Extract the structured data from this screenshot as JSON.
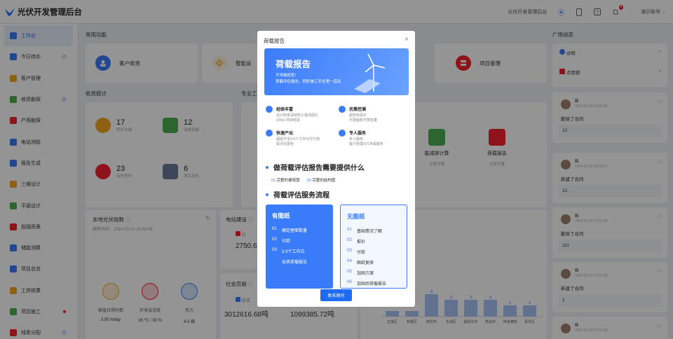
{
  "app": {
    "title": "光伏开发管理后台"
  },
  "topbar": {
    "platform_label": "光伏开发管理后台",
    "notif_count": "3",
    "account_label": "演示账号"
  },
  "sidebar": {
    "items": [
      {
        "label": "工作台",
        "active": true,
        "color": "#3a7bfa"
      },
      {
        "label": "今日待办",
        "badge": "2",
        "badge_type": "green",
        "color": "#3a7bfa"
      },
      {
        "label": "客户管理",
        "color": "#f5a623"
      },
      {
        "label": "收资勘探",
        "badge": "1",
        "badge_type": "blue",
        "color": "#4caf50"
      },
      {
        "label": "产用勘探",
        "color": "#f5222d"
      },
      {
        "label": "电站测绘",
        "color": "#3a7bfa"
      },
      {
        "label": "报告生成",
        "color": "#3a7bfa"
      },
      {
        "label": "三维设计",
        "color": "#f5a623"
      },
      {
        "label": "平面设计",
        "color": "#4caf50"
      },
      {
        "label": "投融资表",
        "color": "#f5222d"
      },
      {
        "label": "储能测算",
        "color": "#3a7bfa"
      },
      {
        "label": "项目总览",
        "color": "#3a7bfa"
      },
      {
        "label": "工资核算",
        "color": "#f5a623"
      },
      {
        "label": "项目施工",
        "dot": true,
        "color": "#4caf50"
      },
      {
        "label": "线索分配",
        "badge": "1",
        "badge_type": "blue",
        "color": "#f5222d"
      }
    ]
  },
  "main": {
    "common_title": "常用功能",
    "quick": [
      {
        "label": "客户收资",
        "color": "#3a7bfa"
      },
      {
        "label": "智能设",
        "color": "#f5a623"
      },
      {
        "label": "项目管理",
        "color": "#f5222d"
      }
    ],
    "stats_title": "收资统计",
    "stats": [
      {
        "num": "17",
        "label": "初步沟通",
        "color": "#f5a623"
      },
      {
        "num": "12",
        "label": "深度挖掘",
        "color": "#4caf50"
      },
      {
        "num": "23",
        "label": "合作签约",
        "color": "#f5222d"
      },
      {
        "num": "6",
        "label": "项目流失",
        "color": "#6b7a99"
      }
    ],
    "pro_title": "专业工",
    "tools": [
      {
        "label": "能减排计算",
        "sub": "立即计算",
        "color": "#4caf50"
      },
      {
        "label": "荷载报告",
        "sub": "立即计算",
        "color": "#f5222d"
      }
    ],
    "pv": {
      "title": "本地光伏指数",
      "update": "更新时间：2024-03-21 10:42:45",
      "items": [
        {
          "label": "峰值日照时数",
          "value": "3.95 h/day",
          "color": "#f5a623"
        },
        {
          "label": "环境温湿度",
          "value": "16 ℃ / 33 %",
          "color": "#f5222d"
        },
        {
          "label": "风力",
          "value": "4-5 级",
          "color": "#3a7bfa"
        }
      ]
    },
    "station": {
      "title": "电站建设",
      "total_label": "总",
      "value": "2750.6"
    },
    "social": {
      "title": "社会贡献",
      "sub": "碳减",
      "value1": "3012616.68吨",
      "value2": "1099385.72吨"
    },
    "chart_data": {
      "type": "bar",
      "categories": [
        "五莲区",
        "新都区",
        "衡阳市",
        "东城区",
        "磁县东市",
        "慈溪市",
        "伊通满族",
        "嘉定区"
      ],
      "values": [
        1,
        1,
        4,
        3,
        3,
        3,
        2,
        2
      ],
      "data_labels": [
        "",
        "",
        "4",
        "3",
        "3",
        "3",
        "2",
        "2"
      ]
    }
  },
  "right": {
    "title": "广场动态",
    "tops": [
      {
        "label": "@榜",
        "color": "#3a7bfa"
      },
      {
        "label": "点赞榜",
        "color": "#f5222d"
      }
    ],
    "feeds": [
      {
        "name": "韩",
        "time": "2024-03-29 19:08:38",
        "action": "删除了合同",
        "value": "12"
      },
      {
        "name": "韩",
        "time": "2024-03-29 19:08:21",
        "action": "新建了合同",
        "value": "12"
      },
      {
        "name": "韩",
        "time": "2024-03-29 17:53:08",
        "action": "删除了合同",
        "value": "111"
      },
      {
        "name": "韩",
        "time": "2024-03-29 17:52:58",
        "action": "新建了合同",
        "value": "1"
      },
      {
        "name": "韩",
        "time": "2024-03-29 17:52:38",
        "action": ""
      }
    ]
  },
  "modal": {
    "title": "荷载报告",
    "banner_title": "荷载报告",
    "banner_line1": "不用被拒拒!",
    "banner_line2": "荷载评估报告，把好施工安全第一道关",
    "features": [
      {
        "title": "经验丰富",
        "lines": [
          "设计院资深结构工程师团队",
          "1000+项目经验"
        ]
      },
      {
        "title": "优惠控满",
        "lines": [
          "超低惊喜价",
          "不限面积不限容量"
        ]
      },
      {
        "title": "快速产出",
        "lines": [
          "图纸齐全3-5个工作日交付荷",
          "载评估报告"
        ]
      },
      {
        "title": "专人服务",
        "lines": [
          "专人服务",
          "客户经理1V1专属服务"
        ]
      }
    ],
    "section1_title": "做荷载评估报告需要提供什么",
    "requirements": [
      {
        "num": "01.",
        "text": "完整的建筑图"
      },
      {
        "num": "02.",
        "text": "完整的结构图"
      }
    ],
    "section2_title": "荷载评估服务流程",
    "with_drawings": {
      "title": "有图纸",
      "steps": [
        {
          "num": "01",
          "text": "确定屋面数量"
        },
        {
          "num": "02",
          "text": "付款"
        },
        {
          "num": "03",
          "text": "3-5个工作日"
        },
        {
          "num": "",
          "text": "出具荷载报告"
        }
      ]
    },
    "without_drawings": {
      "title": "无图纸",
      "steps": [
        {
          "num": "01",
          "text": "基础情况了解"
        },
        {
          "num": "02",
          "text": "报价"
        },
        {
          "num": "03",
          "text": "付款"
        },
        {
          "num": "04",
          "text": "图纸复原"
        },
        {
          "num": "05",
          "text": "加固方案"
        },
        {
          "num": "06",
          "text": "加固后荷载报告"
        }
      ]
    },
    "contact_label": "联系顾问"
  }
}
